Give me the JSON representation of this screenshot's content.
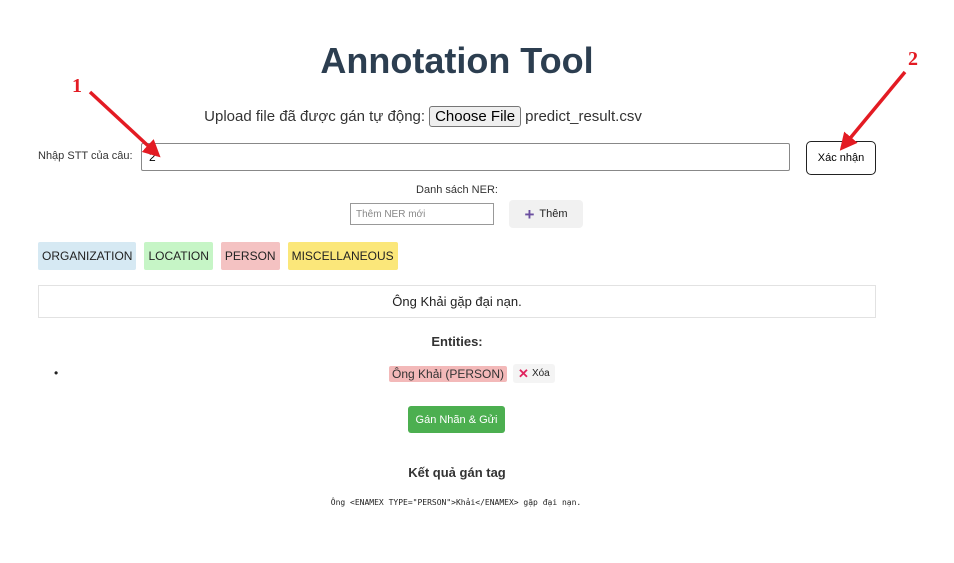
{
  "app": {
    "title": "Annotation Tool"
  },
  "upload": {
    "label": "Upload file đã được gán tự động:",
    "button_label": "Choose File",
    "file_name": "predict_result.csv"
  },
  "sentence_index": {
    "label": "Nhập STT của câu:",
    "value": "2",
    "confirm_label": "Xác nhận"
  },
  "ner": {
    "list_label": "Danh sách NER:",
    "input_placeholder": "Thêm NER mới",
    "add_label": "Thêm",
    "tags": [
      {
        "label": "ORGANIZATION",
        "color": "#d6e9f3"
      },
      {
        "label": "LOCATION",
        "color": "#c6f5c6"
      },
      {
        "label": "PERSON",
        "color": "#f4c2c2"
      },
      {
        "label": "MISCELLANEOUS",
        "color": "#fbe77a"
      }
    ]
  },
  "sentence": {
    "text": "Ông Khải gặp đại nạn."
  },
  "entities": {
    "title": "Entities:",
    "items": [
      {
        "label": "Ông Khải (PERSON)",
        "delete_label": "Xóa"
      }
    ]
  },
  "submit": {
    "label": "Gán Nhãn & Gửi"
  },
  "result": {
    "title": "Kết quả gán tag",
    "text": "Ông <ENAMEX TYPE=\"PERSON\">Khải</ENAMEX> gặp đại nạn."
  },
  "annotations": {
    "marker_1": "1",
    "marker_2": "2",
    "color": "#e31b23"
  }
}
